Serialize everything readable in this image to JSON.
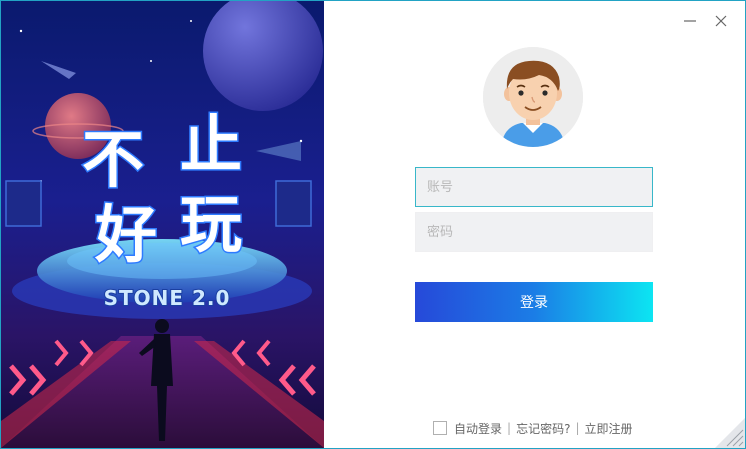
{
  "banner": {
    "slogan_chars": [
      "不",
      "止",
      "好",
      "玩"
    ],
    "version_text": "STONE 2.0"
  },
  "window_controls": {
    "minimize_icon": "minimize-icon",
    "close_icon": "close-icon"
  },
  "login": {
    "account_placeholder": "账号",
    "account_value": "",
    "password_placeholder": "密码",
    "password_value": "",
    "login_label": "登录"
  },
  "footer": {
    "auto_login_label": "自动登录",
    "auto_login_checked": false,
    "separator": "|",
    "forgot_password_label": "忘记密码?",
    "register_label": "立即注册"
  },
  "colors": {
    "accent_border": "#22a3c4",
    "button_gradient_start": "#2649d9",
    "button_gradient_end": "#0ce5f2"
  }
}
